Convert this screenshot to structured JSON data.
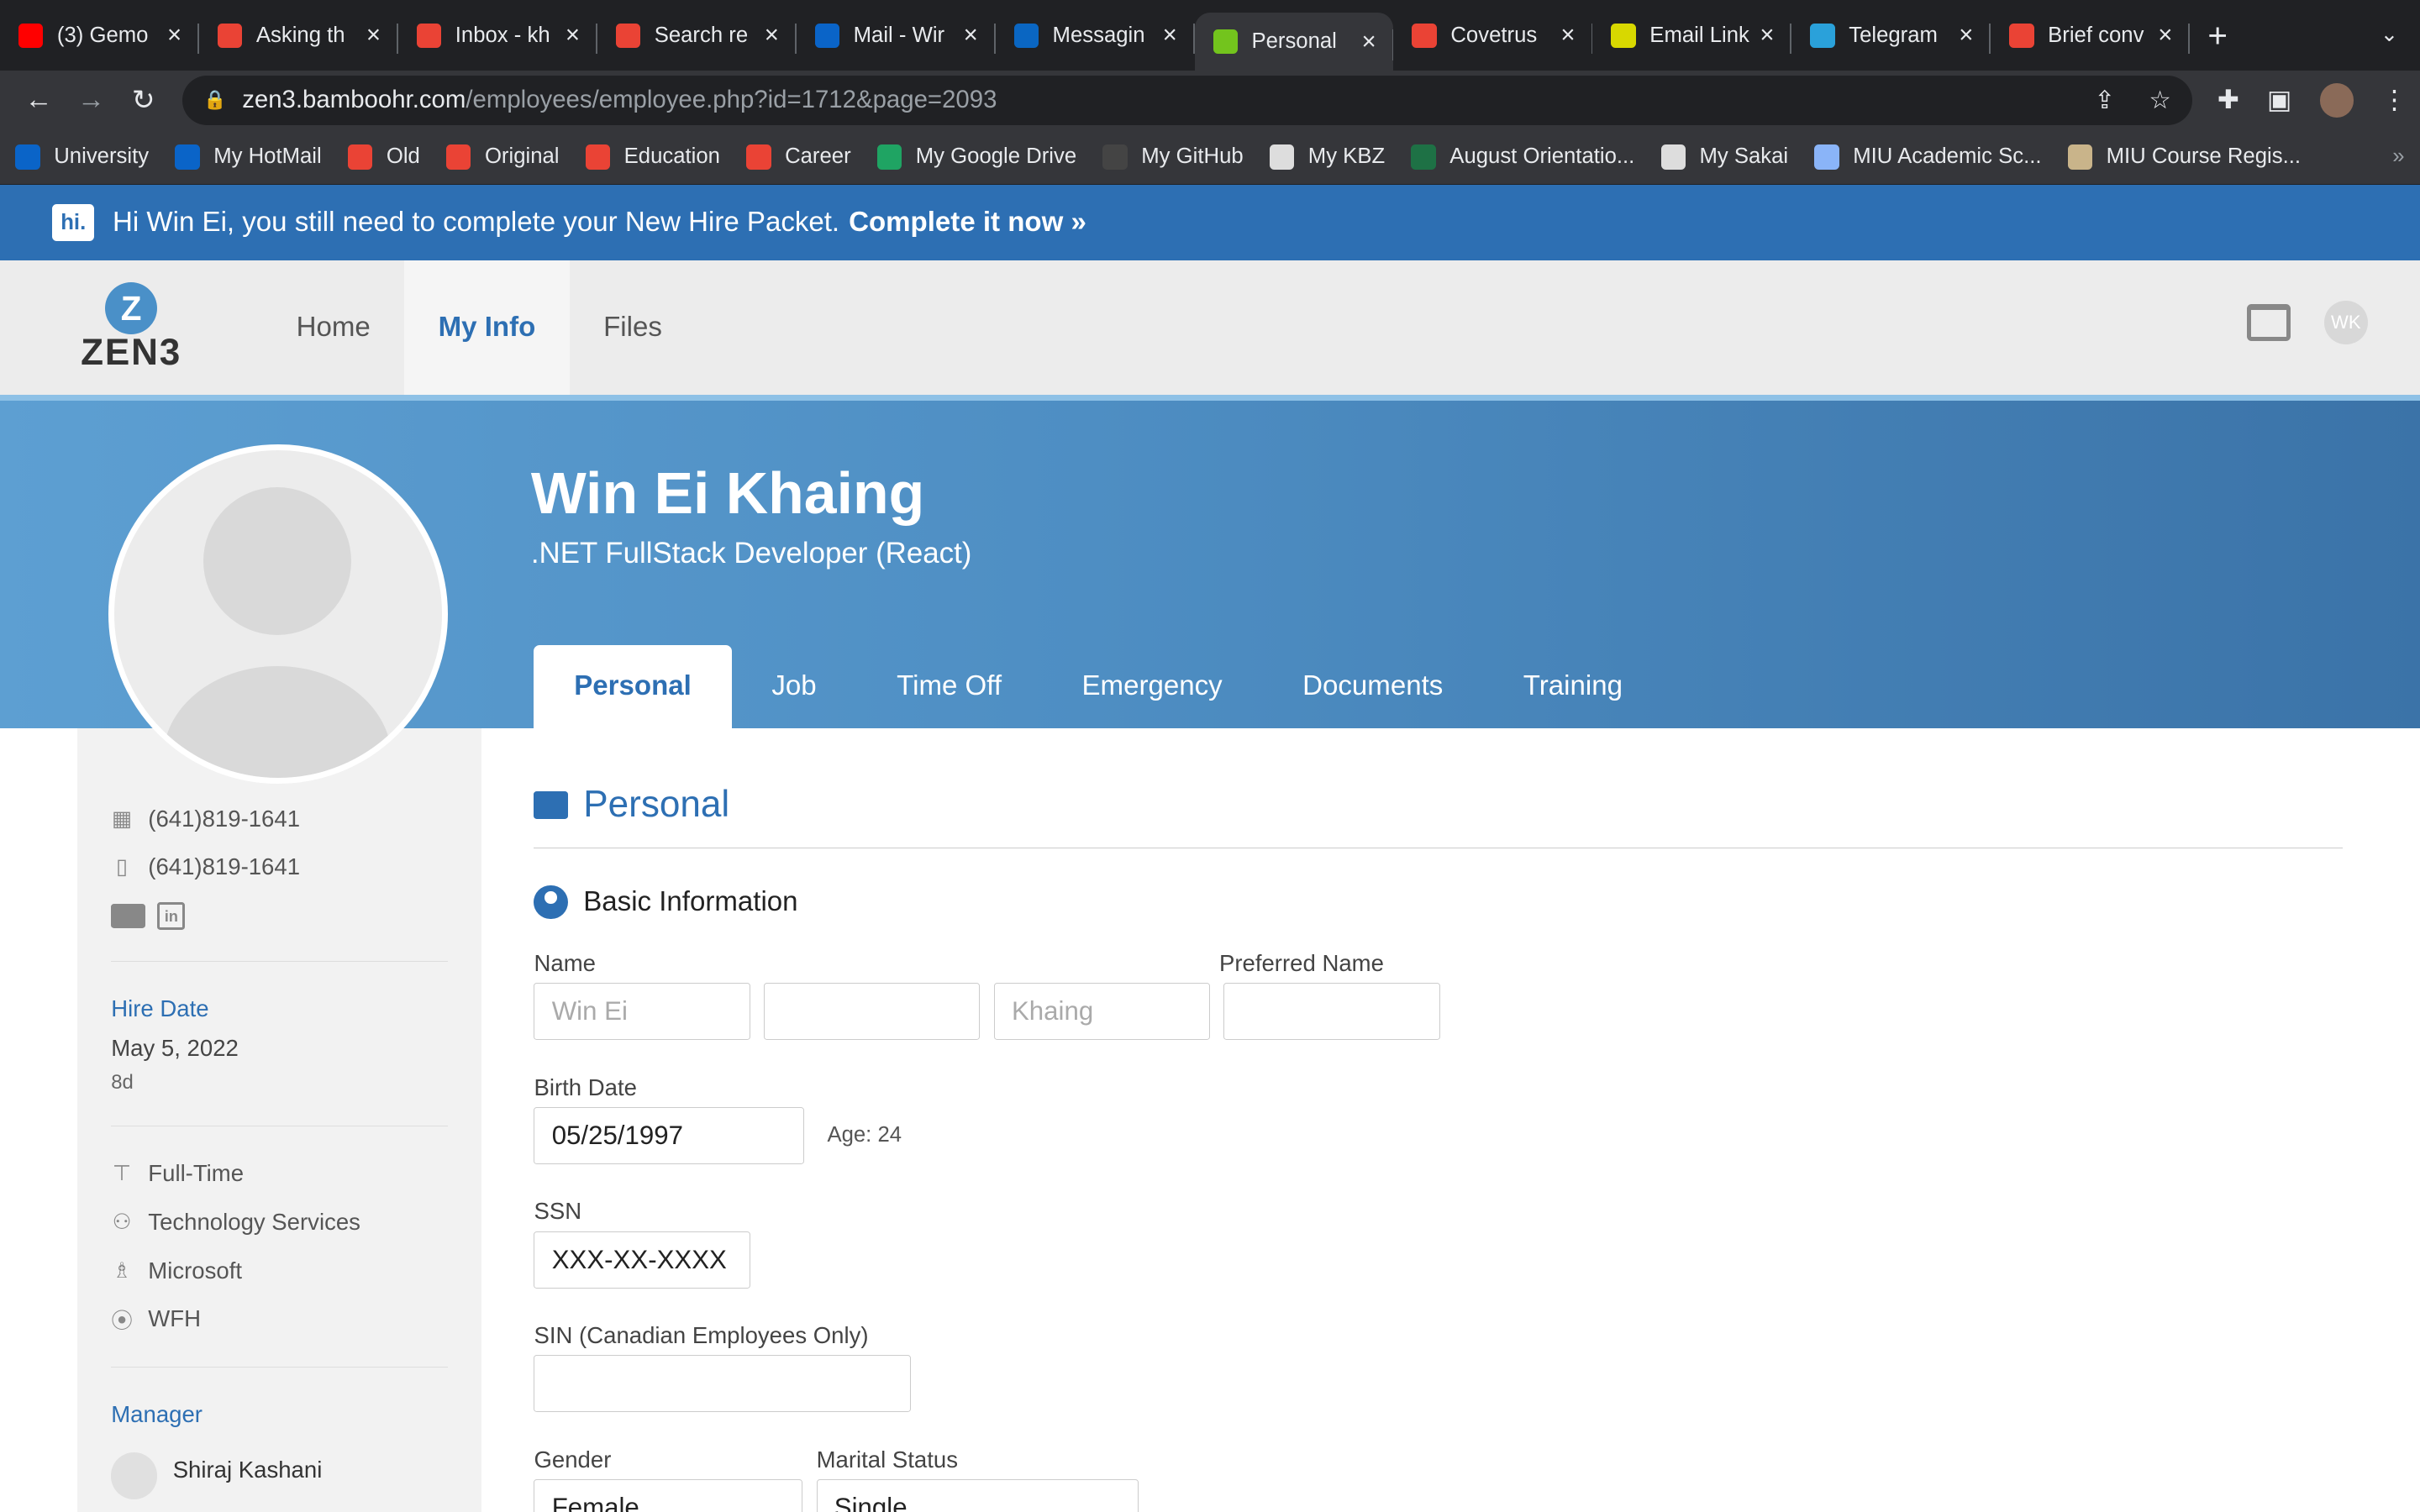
{
  "browser": {
    "tabs": [
      {
        "label": "(3) Gemo",
        "icon": "youtube-icon",
        "color": "#ff0000"
      },
      {
        "label": "Asking th",
        "icon": "gmail-icon",
        "color": "#ea4335"
      },
      {
        "label": "Inbox - kh",
        "icon": "gmail-icon",
        "color": "#ea4335"
      },
      {
        "label": "Search re",
        "icon": "gmail-icon",
        "color": "#ea4335"
      },
      {
        "label": "Mail - Wir",
        "icon": "outlook-icon",
        "color": "#0a64c8"
      },
      {
        "label": "Messagin",
        "icon": "linkedin-icon",
        "color": "#0a66c2"
      },
      {
        "label": "Personal",
        "icon": "bamboohr-icon",
        "color": "#73c41d"
      },
      {
        "label": "Covetrus",
        "icon": "gmail-icon",
        "color": "#ea4335"
      },
      {
        "label": "Email Link",
        "icon": "download-icon",
        "color": "#d8d800"
      },
      {
        "label": "Telegram",
        "icon": "telegram-icon",
        "color": "#2aa1da"
      },
      {
        "label": "Brief conv",
        "icon": "gmail-icon",
        "color": "#ea4335"
      }
    ],
    "url_host": "zen3.bamboohr.com",
    "url_path": "/employees/employee.php?id=1712&page=2093",
    "bookmarks": [
      {
        "label": "University",
        "icon": "outlook-icon",
        "color": "#0a64c8"
      },
      {
        "label": "My HotMail",
        "icon": "outlook-icon",
        "color": "#0a64c8"
      },
      {
        "label": "Old",
        "icon": "gmail-icon",
        "color": "#ea4335"
      },
      {
        "label": "Original",
        "icon": "gmail-icon",
        "color": "#ea4335"
      },
      {
        "label": "Education",
        "icon": "gmail-icon",
        "color": "#ea4335"
      },
      {
        "label": "Career",
        "icon": "gmail-icon",
        "color": "#ea4335"
      },
      {
        "label": "My Google Drive",
        "icon": "google-drive-icon",
        "color": "#1fa463"
      },
      {
        "label": "My GitHub",
        "icon": "github-icon",
        "color": "#444444"
      },
      {
        "label": "My KBZ",
        "icon": "globe-icon",
        "color": "#dddddd"
      },
      {
        "label": "August Orientatio...",
        "icon": "excel-icon",
        "color": "#1e7145"
      },
      {
        "label": "My Sakai",
        "icon": "globe-icon",
        "color": "#dddddd"
      },
      {
        "label": "MIU Academic Sc...",
        "icon": "doc-icon",
        "color": "#8ab4f8"
      },
      {
        "label": "MIU Course Regis...",
        "icon": "miu-icon",
        "color": "#c9b48a"
      }
    ],
    "more": "»"
  },
  "banner": {
    "text": "Hi Win Ei, you still need to complete your New Hire Packet.",
    "link": "Complete it now »",
    "logo": "hi."
  },
  "app": {
    "logo_letter": "Z",
    "logo_text": "ZEN3",
    "nav": [
      "Home",
      "My Info",
      "Files"
    ],
    "avatar_initials": "WK"
  },
  "employee": {
    "name": "Win Ei Khaing",
    "title": ".NET FullStack Developer (React)"
  },
  "profile_tabs": [
    "Personal",
    "Job",
    "Time Off",
    "Emergency",
    "Documents",
    "Training"
  ],
  "sidebar": {
    "work_phone": "(641)819-1641",
    "mobile_phone": "(641)819-1641",
    "hire_date_label": "Hire Date",
    "hire_date": "May 5, 2022",
    "tenure": "8d",
    "employment_type": "Full-Time",
    "department": "Technology Services",
    "division": "Microsoft",
    "location": "WFH",
    "manager_label": "Manager",
    "manager": "Shiraj Kashani"
  },
  "personal": {
    "section_title": "Personal",
    "basic_info_title": "Basic Information",
    "name_label": "Name",
    "first_name_placeholder": "Win Ei",
    "middle_name": "",
    "last_name_placeholder": "Khaing",
    "preferred_name_label": "Preferred Name",
    "preferred_name": "",
    "birth_date_label": "Birth Date",
    "birth_date": "05/25/1997",
    "age": "Age: 24",
    "ssn_label": "SSN",
    "ssn": "XXX-XX-XXXX",
    "sin_label": "SIN (Canadian Employees Only)",
    "sin": "",
    "gender_label": "Gender",
    "gender": "Female",
    "marital_label": "Marital Status",
    "marital": "Single"
  }
}
